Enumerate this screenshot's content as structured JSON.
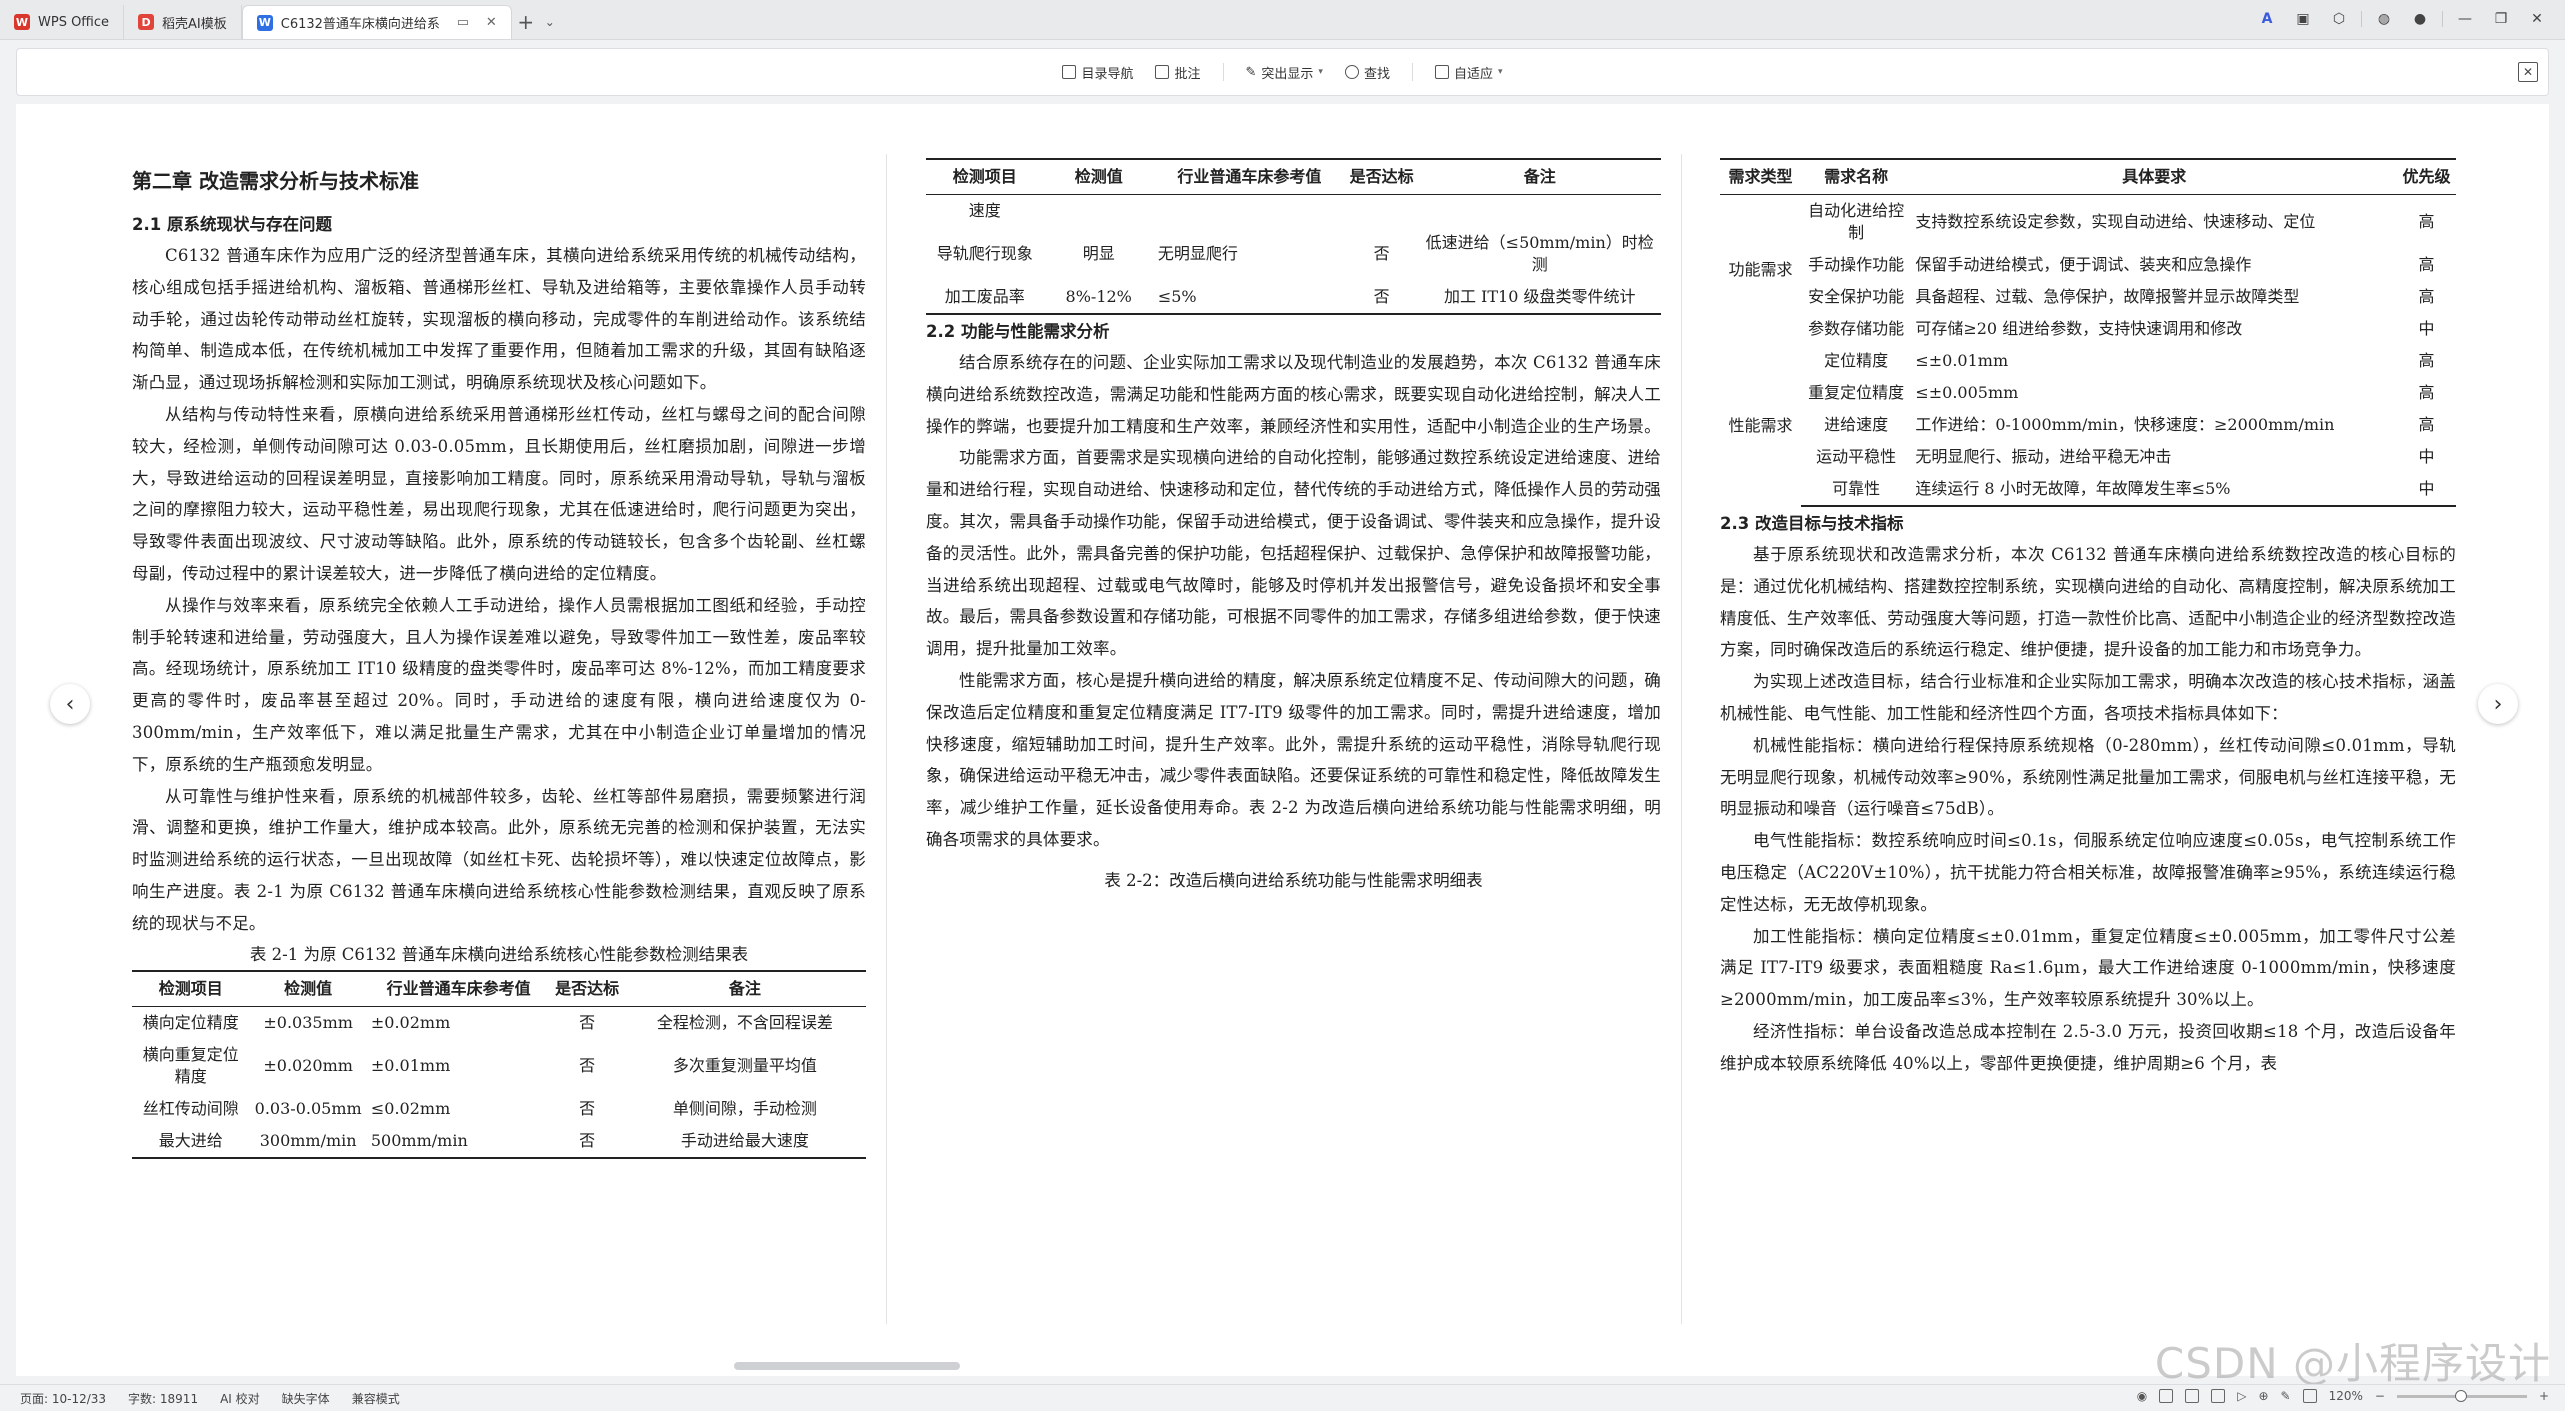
{
  "tabs": [
    {
      "label": "WPS Office"
    },
    {
      "label": "稻壳AI模板"
    },
    {
      "label": "C6132普通车床横向进给系"
    }
  ],
  "toolbar": {
    "toc": "目录导航",
    "annotate": "批注",
    "highlight": "突出显示",
    "find": "查找",
    "fit": "自适应"
  },
  "col1": {
    "chapter": "第二章  改造需求分析与技术标准",
    "section_2_1": "2.1  原系统现状与存在问题",
    "p1": "C6132 普通车床作为应用广泛的经济型普通车床，其横向进给系统采用传统的机械传动结构，核心组成包括手摇进给机构、溜板箱、普通梯形丝杠、导轨及进给箱等，主要依靠操作人员手动转动手轮，通过齿轮传动带动丝杠旋转，实现溜板的横向移动，完成零件的车削进给动作。该系统结构简单、制造成本低，在传统机械加工中发挥了重要作用，但随着加工需求的升级，其固有缺陷逐渐凸显，通过现场拆解检测和实际加工测试，明确原系统现状及核心问题如下。",
    "p2": "从结构与传动特性来看，原横向进给系统采用普通梯形丝杠传动，丝杠与螺母之间的配合间隙较大，经检测，单侧传动间隙可达 0.03-0.05mm，且长期使用后，丝杠磨损加剧，间隙进一步增大，导致进给运动的回程误差明显，直接影响加工精度。同时，原系统采用滑动导轨，导轨与溜板之间的摩擦阻力较大，运动平稳性差，易出现爬行现象，尤其在低速进给时，爬行问题更为突出，导致零件表面出现波纹、尺寸波动等缺陷。此外，原系统的传动链较长，包含多个齿轮副、丝杠螺母副，传动过程中的累计误差较大，进一步降低了横向进给的定位精度。",
    "p3": "从操作与效率来看，原系统完全依赖人工手动进给，操作人员需根据加工图纸和经验，手动控制手轮转速和进给量，劳动强度大，且人为操作误差难以避免，导致零件加工一致性差，废品率较高。经现场统计，原系统加工 IT10 级精度的盘类零件时，废品率可达 8%-12%，而加工精度要求更高的零件时，废品率甚至超过 20%。同时，手动进给的速度有限，横向进给速度仅为 0-300mm/min，生产效率低下，难以满足批量生产需求，尤其在中小制造企业订单量增加的情况下，原系统的生产瓶颈愈发明显。",
    "p4": "从可靠性与维护性来看，原系统的机械部件较多，齿轮、丝杠等部件易磨损，需要频繁进行润滑、调整和更换，维护工作量大，维护成本较高。此外，原系统无完善的检测和保护装置，无法实时监测进给系统的运行状态，一旦出现故障（如丝杠卡死、齿轮损坏等），难以快速定位故障点，影响生产进度。表 2-1 为原 C6132 普通车床横向进给系统核心性能参数检测结果，直观反映了原系统的现状与不足。",
    "caption": "表 2-1 为原 C6132 普通车床横向进给系统核心性能参数检测结果表",
    "table_headers": [
      "检测项目",
      "检测值",
      "行业普通车床参考值",
      "是否达标",
      "备注"
    ],
    "table_rows": [
      [
        "横向定位精度",
        "±0.035mm",
        "±0.02mm",
        "否",
        "全程检测，不含回程误差"
      ],
      [
        "横向重复定位精度",
        "±0.020mm",
        "±0.01mm",
        "否",
        "多次重复测量平均值"
      ],
      [
        "丝杠传动间隙",
        "0.03-0.05mm",
        "≤0.02mm",
        "否",
        "单侧间隙，手动检测"
      ],
      [
        "最大进给",
        "300mm/min",
        "500mm/min",
        "否",
        "手动进给最大速度"
      ]
    ]
  },
  "col2": {
    "table_headers": [
      "检测项目",
      "检测值",
      "行业普通车床参考值",
      "是否达标",
      "备注"
    ],
    "table_rows": [
      [
        "速度",
        "",
        "",
        "",
        ""
      ],
      [
        "导轨爬行现象",
        "明显",
        "无明显爬行",
        "否",
        "低速进给（≤50mm/min）时检测"
      ],
      [
        "加工废品率",
        "8%-12%",
        "≤5%",
        "否",
        "加工 IT10 级盘类零件统计"
      ]
    ],
    "section_2_2": "2.2  功能与性能需求分析",
    "p1": "结合原系统存在的问题、企业实际加工需求以及现代制造业的发展趋势，本次 C6132 普通车床横向进给系统数控改造，需满足功能和性能两方面的核心需求，既要实现自动化进给控制，解决人工操作的弊端，也要提升加工精度和生产效率，兼顾经济性和实用性，适配中小制造企业的生产场景。",
    "p2": "功能需求方面，首要需求是实现横向进给的自动化控制，能够通过数控系统设定进给速度、进给量和进给行程，实现自动进给、快速移动和定位，替代传统的手动进给方式，降低操作人员的劳动强度。其次，需具备手动操作功能，保留手动进给模式，便于设备调试、零件装夹和应急操作，提升设备的灵活性。此外，需具备完善的保护功能，包括超程保护、过载保护、急停保护和故障报警功能，当进给系统出现超程、过载或电气故障时，能够及时停机并发出报警信号，避免设备损坏和安全事故。最后，需具备参数设置和存储功能，可根据不同零件的加工需求，存储多组进给参数，便于快速调用，提升批量加工效率。",
    "p3": "性能需求方面，核心是提升横向进给的精度，解决原系统定位精度不足、传动间隙大的问题，确保改造后定位精度和重复定位精度满足 IT7-IT9 级零件的加工需求。同时，需提升进给速度，增加快移速度，缩短辅助加工时间，提升生产效率。此外，需提升系统的运动平稳性，消除导轨爬行现象，确保进给运动平稳无冲击，减少零件表面缺陷。还要保证系统的可靠性和稳定性，降低故障发生率，减少维护工作量，延长设备使用寿命。表 2-2 为改造后横向进给系统功能与性能需求明细，明确各项需求的具体要求。",
    "caption": "表 2-2：改造后横向进给系统功能与性能需求明细表"
  },
  "col3": {
    "table_headers": [
      "需求类型",
      "需求名称",
      "具体要求",
      "优先级"
    ],
    "group1": "功能需求",
    "group2": "性能需求",
    "rows": [
      [
        "自动化进给控制",
        "支持数控系统设定参数，实现自动进给、快速移动、定位",
        "高"
      ],
      [
        "手动操作功能",
        "保留手动进给模式，便于调试、装夹和应急操作",
        "高"
      ],
      [
        "安全保护功能",
        "具备超程、过载、急停保护，故障报警并显示故障类型",
        "高"
      ],
      [
        "参数存储功能",
        "可存储≥20 组进给参数，支持快速调用和修改",
        "中"
      ],
      [
        "定位精度",
        "≤±0.01mm",
        "高"
      ],
      [
        "重复定位精度",
        "≤±0.005mm",
        "高"
      ],
      [
        "进给速度",
        "工作进给：0-1000mm/min，快移速度：≥2000mm/min",
        "高"
      ],
      [
        "运动平稳性",
        "无明显爬行、振动，进给平稳无冲击",
        "中"
      ],
      [
        "可靠性",
        "连续运行 8 小时无故障，年故障发生率≤5%",
        "中"
      ]
    ],
    "section_2_3": "2.3  改造目标与技术指标",
    "p1": "基于原系统现状和改造需求分析，本次 C6132 普通车床横向进给系统数控改造的核心目标的是：通过优化机械结构、搭建数控控制系统，实现横向进给的自动化、高精度控制，解决原系统加工精度低、生产效率低、劳动强度大等问题，打造一款性价比高、适配中小制造企业的经济型数控改造方案，同时确保改造后的系统运行稳定、维护便捷，提升设备的加工能力和市场竞争力。",
    "p2": "为实现上述改造目标，结合行业标准和企业实际加工需求，明确本次改造的核心技术指标，涵盖机械性能、电气性能、加工性能和经济性四个方面，各项技术指标具体如下：",
    "p3": "机械性能指标：横向进给行程保持原系统规格（0-280mm），丝杠传动间隙≤0.01mm，导轨无明显爬行现象，机械传动效率≥90%，系统刚性满足批量加工需求，伺服电机与丝杠连接平稳，无明显振动和噪音（运行噪音≤75dB）。",
    "p4": "电气性能指标：数控系统响应时间≤0.1s，伺服系统定位响应速度≤0.05s，电气控制系统工作电压稳定（AC220V±10%），抗干扰能力符合相关标准，故障报警准确率≥95%，系统连续运行稳定性达标，无无故停机现象。",
    "p5": "加工性能指标：横向定位精度≤±0.01mm，重复定位精度≤±0.005mm，加工零件尺寸公差满足 IT7-IT9 级要求，表面粗糙度 Ra≤1.6μm，最大工作进给速度 0-1000mm/min，快移速度≥2000mm/min，加工废品率≤3%，生产效率较原系统提升 30%以上。",
    "p6": "经济性指标：单台设备改造总成本控制在 2.5-3.0 万元，投资回收期≤18 个月，改造后设备年维护成本较原系统降低 40%以上，零部件更换便捷，维护周期≥6 个月，表"
  },
  "status": {
    "pages": "页面: 10-12/33",
    "words": "字数: 18911",
    "ai": "AI 校对",
    "font": "缺失字体",
    "compat": "兼容模式",
    "zoom": "120%"
  },
  "watermark": "CSDN @小程序设计"
}
